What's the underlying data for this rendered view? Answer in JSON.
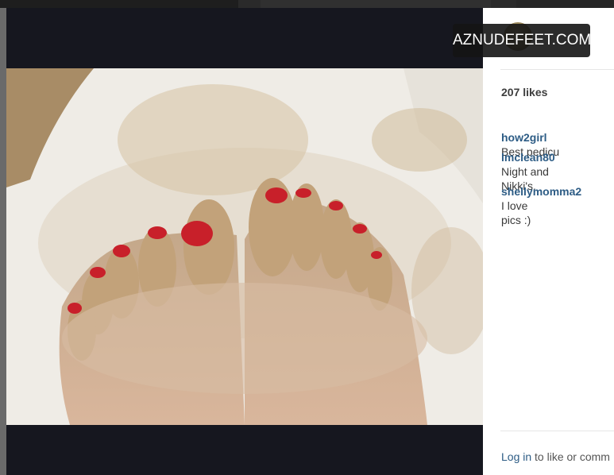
{
  "post": {
    "likes_text": "207 likes",
    "comments": [
      {
        "user": "how2girl",
        "text": "Best pedicu"
      },
      {
        "user": "lmclean80",
        "text": "Night and\nNikki's."
      },
      {
        "user": "shellymomma2",
        "text": "I love\npics :)"
      }
    ]
  },
  "footer": {
    "login_link": "Log in",
    "login_suffix": "to like or comm"
  },
  "watermark": {
    "text": "AZNUDEFEET.COM"
  },
  "colors": {
    "username": "#2d5c85",
    "nail_polish": "#c8202a",
    "frame": "#16171f"
  }
}
